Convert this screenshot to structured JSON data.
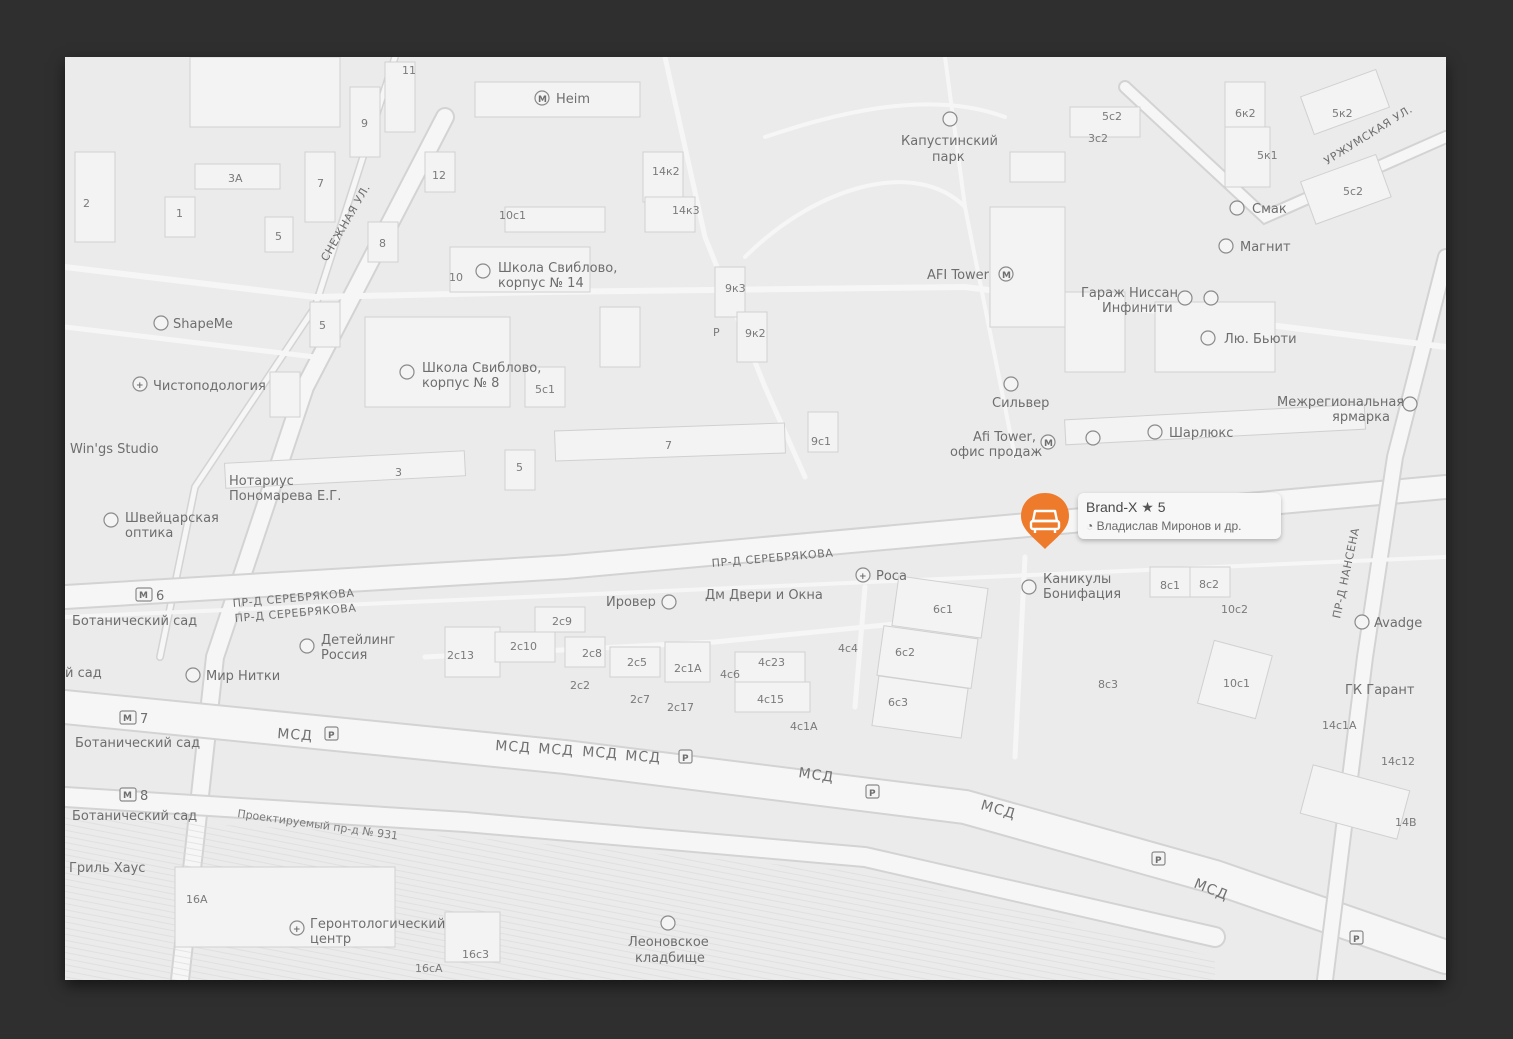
{
  "card": {
    "name": "Brand-X",
    "rating_star": "★",
    "rating": "5",
    "owner_icon": "person-icon",
    "owner": "Владислав Миронов и др."
  },
  "pin": {
    "icon": "car-icon",
    "color": "#ee7a2c"
  },
  "streets": {
    "snezhnaya": "СНЕЖНАЯ УЛ.",
    "serebryakova1": "ПР-Д СЕРЕБРЯКОВА",
    "serebryakova2": "ПР-Д СЕРЕБРЯКОВА",
    "serebryakova3": "ПР-Д СЕРЕБРЯКОВА",
    "urzhumskaya": "УРЖУМСКАЯ УЛ.",
    "nansena": "ПР-Д НАНСЕНА",
    "proj931": "Проектируемый пр-д № 931",
    "msd": "МСД"
  },
  "pois": {
    "heim": "Heim",
    "kapust1": "Капустинский",
    "kapust2": "парк",
    "smak": "Смак",
    "magnit": "Магнит",
    "afi": "AFI Tower",
    "garage1": "Гараж Ниссан",
    "garage2": "Инфинити",
    "lyu": "Лю. Бьюти",
    "school14a": "Школа Свиблово,",
    "school14b": "корпус № 14",
    "school8a": "Школа Свиблово,",
    "school8b": "корпус № 8",
    "shapeme": "ShapeMe",
    "chisto": "Чистоподология",
    "wings": "Win'gs Studio",
    "notar1": "Нотариус",
    "notar2": "Пономарева Е.Г.",
    "shveits1": "Швейцарская",
    "shveits2": "оптика",
    "silver": "Сильвер",
    "afioffice1": "Afi Tower,",
    "afioffice2": "офис продаж",
    "sharlux": "Шарлюкс",
    "mezh1": "Межрегиональная",
    "mezh2": "ярмарка",
    "rosa": "Роса",
    "kanik1": "Каникулы",
    "kanik2": "Бонифация",
    "irover": "Ировер",
    "dm": "Дм Двери и Окна",
    "detail1": "Детейлинг",
    "detail2": "Россия",
    "mir": "Мир Нитки",
    "avadge": "Avadge",
    "garant": "ГК Гарант",
    "grill": "Гриль Хаус",
    "geront1": "Геронтологический",
    "geront2": "центр",
    "leon1": "Леоновское",
    "leon2": "кладбище",
    "bot6": "Ботанический сад",
    "bot7": "Ботанический сад",
    "bot8": "Ботанический сад",
    "botcut": "й сад",
    "m6": "6",
    "m7": "7",
    "m8": "8"
  },
  "buildings": [
    "11",
    "9",
    "7",
    "3А",
    "2",
    "1",
    "5",
    "12",
    "8",
    "10с1",
    "10",
    "14к2",
    "14к3",
    "9к3",
    "9к2",
    "5",
    "5с1",
    "7",
    "9с1",
    "3",
    "5",
    "5с2",
    "3с2",
    "6к2",
    "5к2",
    "5к1",
    "5с2",
    "2с9",
    "2с10",
    "2с8",
    "2с5",
    "2с13",
    "2с1А",
    "2с2",
    "2с7",
    "2с17",
    "4с23",
    "4с6",
    "4с15",
    "4с1А",
    "4с4",
    "6с1",
    "6с2",
    "6с3",
    "8с1",
    "8с2",
    "10с2",
    "8с3",
    "10с1",
    "14с1А",
    "14с12",
    "14В",
    "16А",
    "16с3",
    "16сА"
  ]
}
